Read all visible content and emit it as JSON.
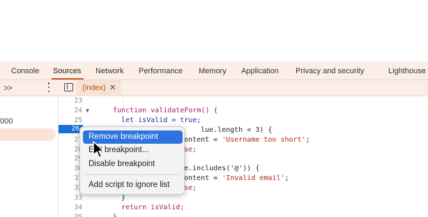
{
  "panel_tabs": [
    "Console",
    "Sources",
    "Network",
    "Performance",
    "Memory",
    "Application",
    "Privacy and security",
    "Lighthouse"
  ],
  "active_panel_tab": "Sources",
  "toolbar": {
    "more_tabs_icon": "double-chevron-right-icon",
    "menu_icon": "kebab-menu-icon",
    "sidebar_icon": "toggle-sidebar-icon"
  },
  "file_tab": {
    "label": "(index)",
    "close": "✕"
  },
  "navigator": {
    "visible_text": "000"
  },
  "editor": {
    "line_numbers": [
      "23",
      "24",
      "25",
      "26",
      "27",
      "28",
      "29",
      "30",
      "31",
      "32",
      "33",
      "34",
      "35"
    ],
    "breakpoint_line": "26",
    "code_lines": {
      "l24": "function validateForm() {",
      "l25": "let isValid = true;",
      "l26": "lue.length < 3) {",
      "l27_a": "ontent = ",
      "l27_b": "'Username too short'",
      "l27_c": ";",
      "l28": "se;",
      "l30": "e.includes('@')) {",
      "l31_a": "ontent = ",
      "l31_b": "'Invalid email'",
      "l31_c": ";",
      "l32": "se;",
      "l33": "}",
      "l34": "return isValid;",
      "l35": "}"
    }
  },
  "context_menu": {
    "items": [
      "Remove breakpoint",
      "Edit breakpoint...",
      "Disable breakpoint",
      "Add script to ignore list"
    ],
    "highlighted": "Remove breakpoint",
    "accent_color": "#2e74de"
  },
  "colors": {
    "panel_bg": "#fbeee6",
    "active_tab_accent": "#c5591b",
    "breakpoint_blue": "#1a6fd6"
  }
}
